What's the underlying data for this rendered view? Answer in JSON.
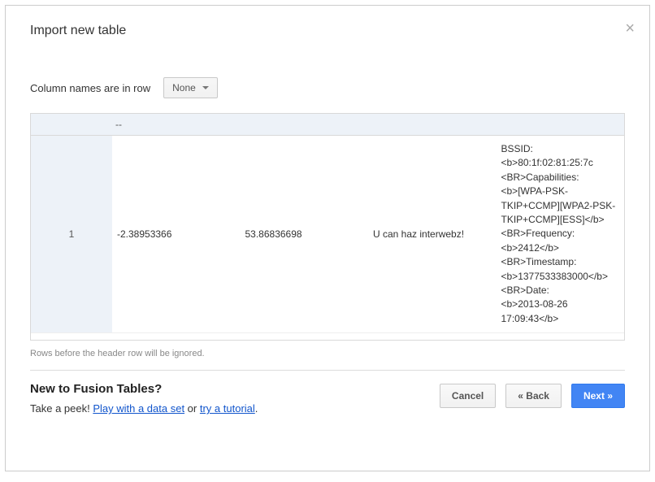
{
  "dialog": {
    "title": "Import new table"
  },
  "columnNames": {
    "label": "Column names are in row",
    "selected": "None"
  },
  "table": {
    "headers": [
      "",
      "--",
      "",
      "",
      "",
      ""
    ],
    "row": {
      "num": "1",
      "c1": "-2.38953366",
      "c2": "53.86836698",
      "c3": "U can haz interwebz!",
      "c4": "BSSID:\n<b>80:1f:02:81:25:7c\n<BR>Capabilities:\n<b>[WPA-PSK-TKIP+CCMP][WPA2-PSK-TKIP+CCMP][ESS]</b>\n<BR>Frequency:\n<b>2412</b>\n<BR>Timestamp:\n<b>1377533383000</b>\n<BR>Date:\n<b>2013-08-26 17:09:43</b>"
    }
  },
  "hint": "Rows before the header row will be ignored.",
  "footer": {
    "heading": "New to Fusion Tables?",
    "peek_prefix": "Take a peek! ",
    "link1": "Play with a data set",
    "or": " or ",
    "link2": "try a tutorial",
    "suffix": "."
  },
  "buttons": {
    "cancel": "Cancel",
    "back": "« Back",
    "next": "Next »"
  }
}
